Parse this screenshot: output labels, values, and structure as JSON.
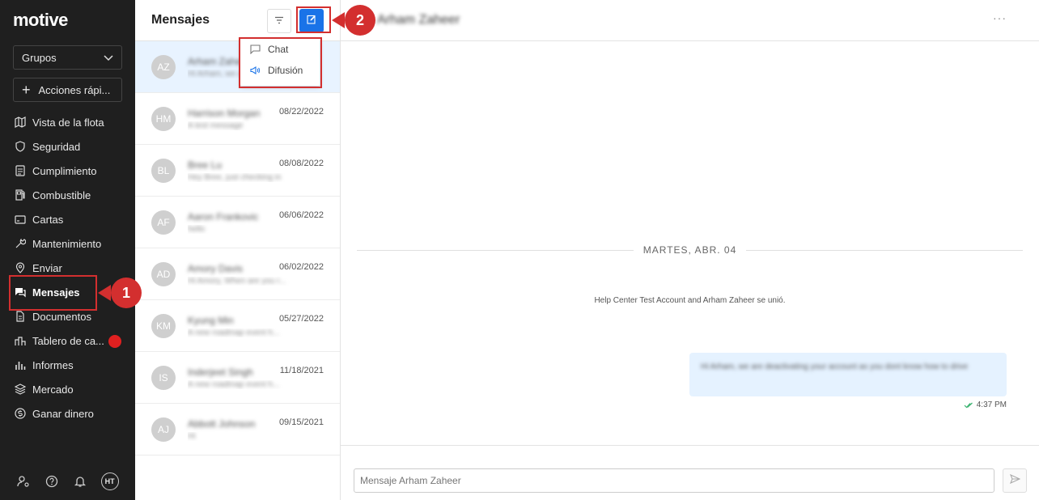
{
  "brand": {
    "logo_text": "motive"
  },
  "sidebar": {
    "groups_label": "Grupos",
    "quick_actions_label": "Acciones rápi...",
    "items": [
      {
        "label": "Vista de la flota",
        "icon": "map-icon"
      },
      {
        "label": "Seguridad",
        "icon": "shield-icon"
      },
      {
        "label": "Cumplimiento",
        "icon": "document-icon"
      },
      {
        "label": "Combustible",
        "icon": "fuel-icon"
      },
      {
        "label": "Cartas",
        "icon": "card-icon"
      },
      {
        "label": "Mantenimiento",
        "icon": "wrench-icon"
      },
      {
        "label": "Enviar",
        "icon": "location-pin-icon"
      },
      {
        "label": "Mensajes",
        "icon": "chat-icon",
        "active": true
      },
      {
        "label": "Documentos",
        "icon": "file-icon"
      },
      {
        "label": "Tablero de ca...",
        "icon": "dashboard-icon",
        "notification": true
      },
      {
        "label": "Informes",
        "icon": "bar-chart-icon"
      },
      {
        "label": "Mercado",
        "icon": "layers-icon"
      },
      {
        "label": "Ganar dinero",
        "icon": "dollar-icon"
      }
    ],
    "bottom": {
      "user_initials": "HT"
    }
  },
  "messages": {
    "title": "Mensajes",
    "conversations": [
      {
        "initials": "AZ",
        "name": "Arham Zaheer",
        "preview": "Hi Arham, we are deac",
        "date": "",
        "selected": true
      },
      {
        "initials": "HM",
        "name": "Harrison Morgan",
        "preview": "A test message",
        "date": "08/22/2022"
      },
      {
        "initials": "BL",
        "name": "Bree Lu",
        "preview": "Hey Bree, just checking in",
        "date": "08/08/2022"
      },
      {
        "initials": "AF",
        "name": "Aaron Frankovic",
        "preview": "hello",
        "date": "06/06/2022"
      },
      {
        "initials": "AD",
        "name": "Amory Davis",
        "preview": "Hi Amory, When are you r...",
        "date": "06/02/2022"
      },
      {
        "initials": "KM",
        "name": "Kyung Min",
        "preview": "A new roadmap event h...",
        "date": "05/27/2022"
      },
      {
        "initials": "IS",
        "name": "Inderjeet Singh",
        "preview": "A new roadmap event h...",
        "date": "11/18/2021"
      },
      {
        "initials": "AJ",
        "name": "Abbott Johnson",
        "preview": "Hi",
        "date": "09/15/2021"
      }
    ],
    "new_menu": {
      "chat_label": "Chat",
      "broadcast_label": "Difusión"
    }
  },
  "callouts": {
    "one": "1",
    "two": "2"
  },
  "chat": {
    "title": "Arham Zaheer",
    "more": "···",
    "date_separator": "MARTES, ABR. 04",
    "system_message": "Help Center Test Account and Arham Zaheer se unió.",
    "message_text": "Hi Arham, we are deactivating your account as you dont know how to drive",
    "message_time": "4:37 PM",
    "composer_placeholder": "Mensaje Arham Zaheer"
  },
  "colors": {
    "accent": "#1a73e8",
    "sidebar_bg": "#1f1f1f",
    "callout": "#d32f2f",
    "selected_row": "#e8f3ff"
  }
}
